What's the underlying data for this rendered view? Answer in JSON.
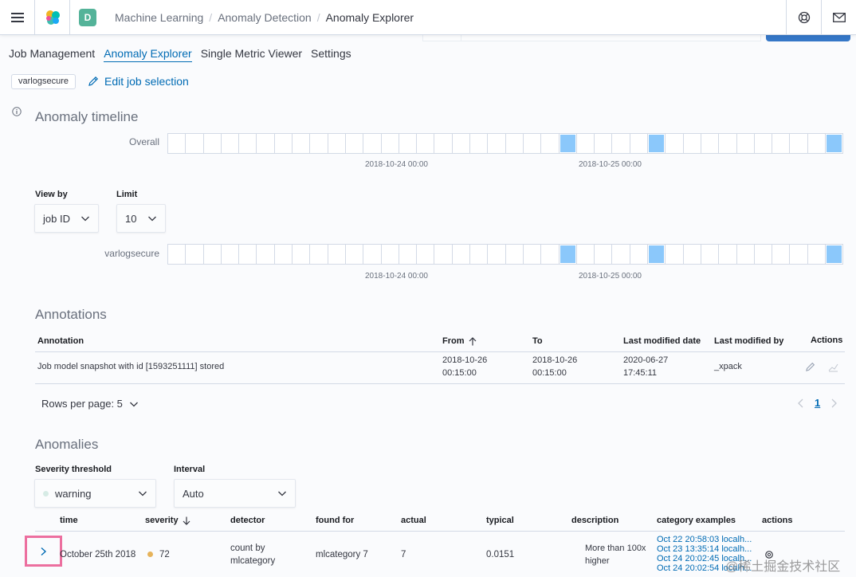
{
  "header": {
    "space_initial": "D",
    "breadcrumbs": [
      "Machine Learning",
      "Anomaly Detection",
      "Anomaly Explorer"
    ]
  },
  "tabs": [
    "Job Management",
    "Anomaly Explorer",
    "Single Metric Viewer",
    "Settings"
  ],
  "job_badge": "varlogsecure",
  "edit_job_label": "Edit job selection",
  "timeline": {
    "title": "Anomaly timeline",
    "overall_label": "Overall",
    "view_by_label": "View by",
    "view_by_value": "job ID",
    "limit_label": "Limit",
    "limit_value": "10",
    "job_lane_label": "varlogsecure",
    "axis_ticks": [
      "2018-10-24 00:00",
      "2018-10-25 00:00"
    ],
    "anomaly_cells": [
      22,
      27,
      37
    ]
  },
  "annotations": {
    "title": "Annotations",
    "columns": [
      "Annotation",
      "From",
      "To",
      "Last modified date",
      "Last modified by",
      "Actions"
    ],
    "row": {
      "annotation": "Job model snapshot with id [1593251111] stored",
      "from_date": "2018-10-26",
      "from_time": "00:15:00",
      "to_date": "2018-10-26",
      "to_time": "00:15:00",
      "modified_date": "2020-06-27",
      "modified_time": "17:45:11",
      "modified_by": "_xpack"
    },
    "rows_per_page": "Rows per page: 5",
    "current_page": "1"
  },
  "anomalies": {
    "title": "Anomalies",
    "severity_label": "Severity threshold",
    "severity_value": "warning",
    "interval_label": "Interval",
    "interval_value": "Auto",
    "columns": [
      "time",
      "severity",
      "detector",
      "found for",
      "actual",
      "typical",
      "description",
      "category examples",
      "actions"
    ],
    "row": {
      "time": "October 25th 2018",
      "severity": "72",
      "detector_1": "count by",
      "detector_2": "mlcategory",
      "found_for": "mlcategory 7",
      "actual": "7",
      "typical": "0.0151",
      "description_1": "More than 100x",
      "description_2": "higher",
      "examples": [
        "Oct 22 20:58:03 localh...",
        "Oct 23 13:35:14 localh...",
        "Oct 24 20:02:45 localh...",
        "Oct 24 20:02:54 localh..."
      ]
    }
  },
  "watermark": "@稀土掘金技术社区"
}
